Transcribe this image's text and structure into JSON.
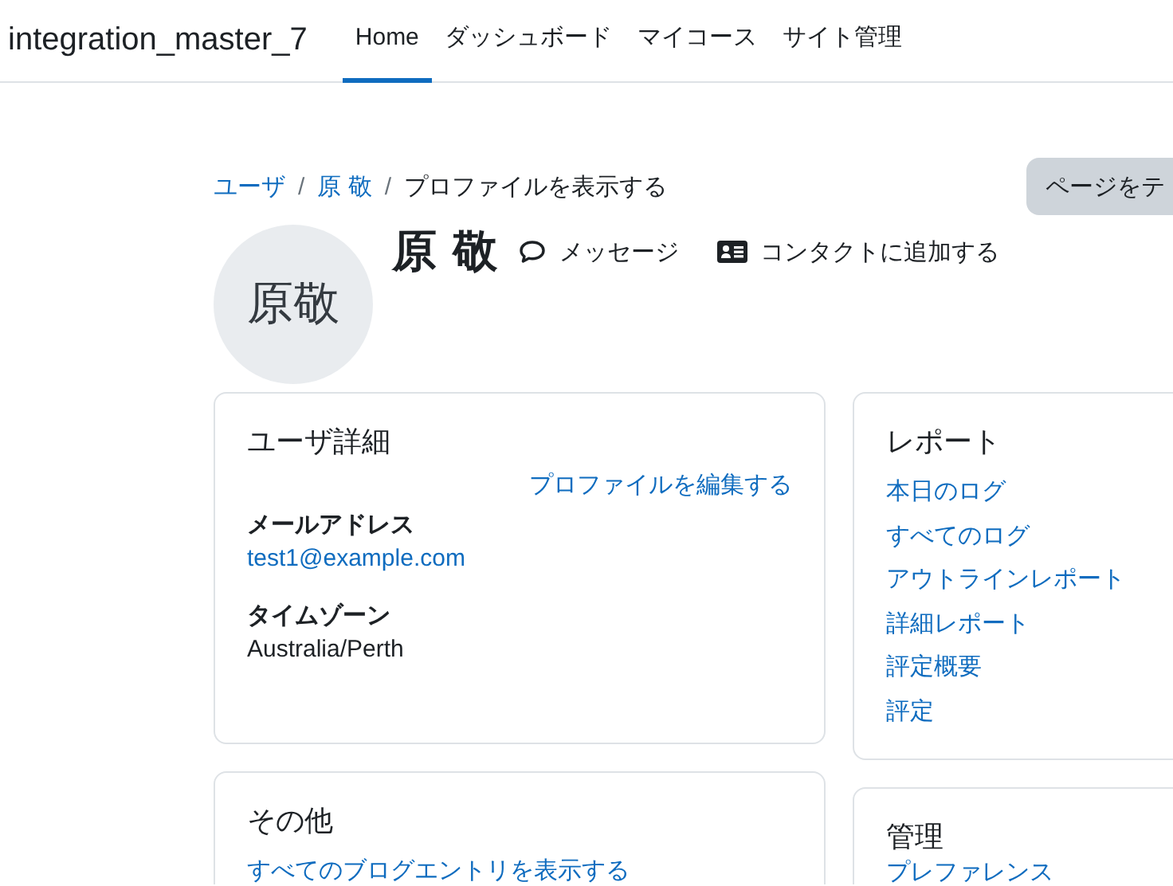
{
  "navbar": {
    "brand": "integration_master_7",
    "items": [
      {
        "label": "Home",
        "selected": true
      },
      {
        "label": "ダッシュボード",
        "selected": false
      },
      {
        "label": "マイコース",
        "selected": false
      },
      {
        "label": "サイト管理",
        "selected": false
      }
    ]
  },
  "breadcrumb": [
    {
      "kind": "link",
      "label": "ユーザ"
    },
    {
      "kind": "separator",
      "label": "/"
    },
    {
      "kind": "link",
      "label": "原 敬"
    },
    {
      "kind": "separator",
      "label": "/"
    },
    {
      "kind": "current",
      "label": "プロファイルを表示する"
    }
  ],
  "page_button": "ページをテ",
  "profile": {
    "avatar_text": "原敬",
    "name": "原 敬",
    "actions": [
      {
        "kind": "message",
        "label": "メッセージ"
      },
      {
        "kind": "contact",
        "label": "コンタクトに追加する"
      }
    ]
  },
  "user_details": {
    "title": "ユーザ詳細",
    "edit_link": "プロファイルを編集する",
    "fields": [
      {
        "label": "メールアドレス",
        "value": "test1@example.com",
        "link": true
      },
      {
        "label": "タイムゾーン",
        "value": "Australia/Perth",
        "link": false
      }
    ]
  },
  "reports": {
    "title": "レポート",
    "links": [
      "本日のログ",
      "すべてのログ",
      "アウトラインレポート",
      "詳細レポート",
      "評定概要",
      "評定"
    ]
  },
  "misc": {
    "title": "その他",
    "links": [
      "すべてのブログエントリを表示する"
    ]
  },
  "admin": {
    "title": "管理",
    "links": [
      "プレファレンス"
    ]
  }
}
